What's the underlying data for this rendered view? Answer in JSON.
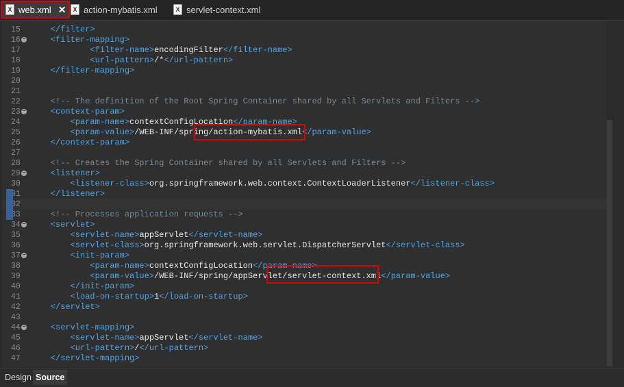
{
  "tabs": [
    {
      "label": "web.xml",
      "icon": "xml-file-icon"
    },
    {
      "label": "action-mybatis.xml",
      "icon": "xml-file-icon"
    },
    {
      "label": "servlet-context.xml",
      "icon": "xml-file-icon"
    }
  ],
  "close_glyph": "✕",
  "bottom_tabs": {
    "design": "Design",
    "source": "Source"
  },
  "lines": [
    {
      "n": "15",
      "fold": false,
      "segs": [
        [
          "t",
          "    </filter>"
        ]
      ]
    },
    {
      "n": "16",
      "fold": true,
      "segs": [
        [
          "t",
          "    <filter-mapping>"
        ]
      ]
    },
    {
      "n": "17",
      "fold": false,
      "segs": [
        [
          "t",
          "            <filter-name>"
        ],
        [
          "x",
          "encodingFilter"
        ],
        [
          "t",
          "</filter-name>"
        ]
      ]
    },
    {
      "n": "18",
      "fold": false,
      "segs": [
        [
          "t",
          "            <url-pattern>"
        ],
        [
          "x",
          "/*"
        ],
        [
          "t",
          "</url-pattern>"
        ]
      ]
    },
    {
      "n": "19",
      "fold": false,
      "segs": [
        [
          "t",
          "    </filter-mapping>"
        ]
      ]
    },
    {
      "n": "20",
      "fold": false,
      "segs": []
    },
    {
      "n": "21",
      "fold": false,
      "segs": []
    },
    {
      "n": "22",
      "fold": false,
      "segs": [
        [
          "c",
          "    <!-- The definition of the Root Spring Container shared by all Servlets and Filters -->"
        ]
      ]
    },
    {
      "n": "23",
      "fold": true,
      "segs": [
        [
          "t",
          "    <context-param>"
        ]
      ]
    },
    {
      "n": "24",
      "fold": false,
      "segs": [
        [
          "t",
          "        <param-name>"
        ],
        [
          "x",
          "contextConfigLocation"
        ],
        [
          "t",
          "</param-name>"
        ]
      ]
    },
    {
      "n": "25",
      "fold": false,
      "segs": [
        [
          "t",
          "        <param-value>"
        ],
        [
          "x",
          "/WEB-INF/spring/action-mybatis.xml"
        ],
        [
          "t",
          "</param-value>"
        ]
      ]
    },
    {
      "n": "26",
      "fold": false,
      "segs": [
        [
          "t",
          "    </context-param>"
        ]
      ]
    },
    {
      "n": "27",
      "fold": false,
      "segs": []
    },
    {
      "n": "28",
      "fold": false,
      "segs": [
        [
          "c",
          "    <!-- Creates the Spring Container shared by all Servlets and Filters -->"
        ]
      ]
    },
    {
      "n": "29",
      "fold": true,
      "segs": [
        [
          "t",
          "    <listener>"
        ]
      ]
    },
    {
      "n": "30",
      "fold": false,
      "segs": [
        [
          "t",
          "        <listener-class>"
        ],
        [
          "x",
          "org.springframework.web.context.ContextLoaderListener"
        ],
        [
          "t",
          "</listener-class>"
        ]
      ]
    },
    {
      "n": "31",
      "fold": false,
      "segs": [
        [
          "t",
          "    </listener>"
        ]
      ]
    },
    {
      "n": "32",
      "fold": false,
      "segs": []
    },
    {
      "n": "33",
      "fold": false,
      "segs": [
        [
          "c",
          "    <!-- Processes application requests -->"
        ]
      ]
    },
    {
      "n": "34",
      "fold": true,
      "segs": [
        [
          "t",
          "    <servlet>"
        ]
      ]
    },
    {
      "n": "35",
      "fold": false,
      "segs": [
        [
          "t",
          "        <servlet-name>"
        ],
        [
          "x",
          "appServlet"
        ],
        [
          "t",
          "</servlet-name>"
        ]
      ]
    },
    {
      "n": "36",
      "fold": false,
      "segs": [
        [
          "t",
          "        <servlet-class>"
        ],
        [
          "x",
          "org.springframework.web.servlet.DispatcherServlet"
        ],
        [
          "t",
          "</servlet-class>"
        ]
      ]
    },
    {
      "n": "37",
      "fold": true,
      "segs": [
        [
          "t",
          "        <init-param>"
        ]
      ]
    },
    {
      "n": "38",
      "fold": false,
      "segs": [
        [
          "t",
          "            <param-name>"
        ],
        [
          "x",
          "contextConfigLocation"
        ],
        [
          "t",
          "</param-name>"
        ]
      ]
    },
    {
      "n": "39",
      "fold": false,
      "segs": [
        [
          "t",
          "            <param-value>"
        ],
        [
          "x",
          "/WEB-INF/spring/appServlet/servlet-context.xml"
        ],
        [
          "t",
          "</param-value>"
        ]
      ]
    },
    {
      "n": "40",
      "fold": false,
      "segs": [
        [
          "t",
          "        </init-param>"
        ]
      ]
    },
    {
      "n": "41",
      "fold": false,
      "segs": [
        [
          "t",
          "        <load-on-startup>"
        ],
        [
          "x",
          "1"
        ],
        [
          "t",
          "</load-on-startup>"
        ]
      ]
    },
    {
      "n": "42",
      "fold": false,
      "segs": [
        [
          "t",
          "    </servlet>"
        ]
      ]
    },
    {
      "n": "43",
      "fold": false,
      "segs": []
    },
    {
      "n": "44",
      "fold": true,
      "segs": [
        [
          "t",
          "    <servlet-mapping>"
        ]
      ]
    },
    {
      "n": "45",
      "fold": false,
      "segs": [
        [
          "t",
          "        <servlet-name>"
        ],
        [
          "x",
          "appServlet"
        ],
        [
          "t",
          "</servlet-name>"
        ]
      ]
    },
    {
      "n": "46",
      "fold": false,
      "segs": [
        [
          "t",
          "        <url-pattern>"
        ],
        [
          "x",
          "/"
        ],
        [
          "t",
          "</url-pattern>"
        ]
      ]
    },
    {
      "n": "47",
      "fold": false,
      "segs": [
        [
          "t",
          "    </servlet-mapping>"
        ]
      ]
    }
  ]
}
